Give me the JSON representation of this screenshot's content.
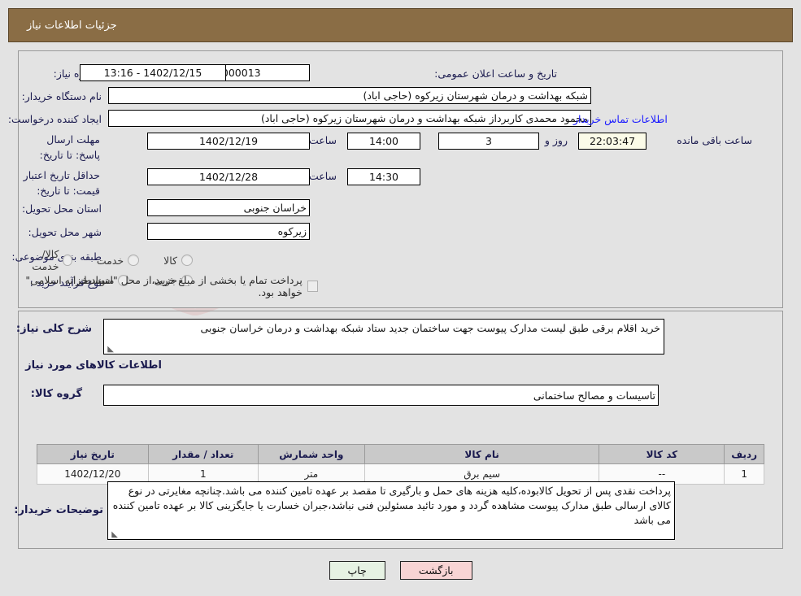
{
  "header": {
    "title": "جزئیات اطلاعات نیاز"
  },
  "form": {
    "need_number_label": "شماره نیاز:",
    "need_number_value": "1102092044000013",
    "announce_datetime_label": "تاریخ و ساعت اعلان عمومی:",
    "announce_datetime_value": "1402/12/15 - 13:16",
    "buyer_org_label": "نام دستگاه خریدار:",
    "buyer_org_value": "شبکه بهداشت و درمان شهرستان زیرکوه (حاجی اباد)",
    "requester_label": "ایجاد کننده درخواست:",
    "requester_value": "محمود محمدی کاربرداز شبکه بهداشت و درمان شهرستان زیرکوه (حاجی اباد)",
    "contact_link": "اطلاعات تماس خریدار",
    "response_deadline_label": "مهلت ارسال پاسخ: تا تاریخ:",
    "response_deadline_date": "1402/12/19",
    "response_deadline_hour_label": "ساعت",
    "response_deadline_hour": "14:00",
    "remaining_days": "3",
    "remaining_days_label": "روز و",
    "remaining_time": "22:03:47",
    "remaining_suffix": "ساعت باقی مانده",
    "price_validity_label": "حداقل تاریخ اعتبار قیمت: تا تاریخ:",
    "price_validity_date": "1402/12/28",
    "price_validity_hour_label": "ساعت",
    "price_validity_hour": "14:30",
    "province_label": "استان محل تحویل:",
    "province_value": "خراسان جنوبی",
    "city_label": "شهر محل تحویل:",
    "city_value": "زیرکوه",
    "category_label": "طبقه بندی موضوعی:",
    "category_options": [
      "کالا",
      "خدمت",
      "کالا/خدمت"
    ],
    "purchase_type_label": "نوع فرآیند خرید :",
    "purchase_type_options": [
      "جزیی",
      "متوسط"
    ],
    "treasury_checkbox_label": "پرداخت تمام یا بخشی از مبلغ خرید،از محل \"اسناد خزانه اسلامی\" خواهد بود."
  },
  "need_summary": {
    "label": "شرح کلی نیاز:",
    "value": "خرید اقلام برقی طبق لیست مدارک پیوست جهت ساختمان جدید ستاد شبکه بهداشت و درمان خراسان جنوبی"
  },
  "goods_section": {
    "heading": "اطلاعات کالاهای مورد نیاز",
    "group_label": "گروه کالا:",
    "group_value": "تاسیسات و مصالح ساختمانی",
    "columns": [
      "ردیف",
      "کد کالا",
      "نام کالا",
      "واحد شمارش",
      "تعداد / مقدار",
      "تاریخ نیاز"
    ],
    "rows": [
      {
        "row": "1",
        "code": "--",
        "name": "سیم برق",
        "unit": "متر",
        "qty": "1",
        "need_date": "1402/12/20"
      }
    ]
  },
  "buyer_notes": {
    "label": "توضیحات خریدار:",
    "value": "پرداخت نقدی پس از تحویل کالابوده،کلیه هزینه های حمل و بارگیری تا مقصد بر عهده تامین کننده می باشد.چنانچه مغایرتی در نوع کالای ارسالی طبق مدارک پیوست مشاهده گردد و مورد تائید مسئولین فنی نباشد،جبران خسارت یا جایگزینی کالا بر عهده تامین کننده می باشد"
  },
  "buttons": {
    "print": "چاپ",
    "back": "بازگشت"
  },
  "watermark": {
    "text": "AriaTender.net"
  },
  "colors": {
    "header_bg": "#8a6d45",
    "label": "#1b1b4f",
    "link": "#1a1aff",
    "timer_bg": "#fbfbe8",
    "print_btn": "#e6f2e3",
    "back_btn": "#f8d4d4"
  }
}
